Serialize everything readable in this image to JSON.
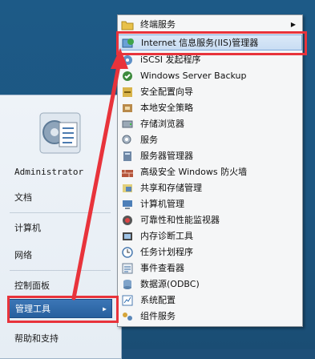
{
  "start_menu": {
    "user_name": "Administrator",
    "items": [
      {
        "label": "文档"
      },
      {
        "label": "计算机"
      },
      {
        "label": "网络"
      },
      {
        "label": "控制面板"
      },
      {
        "label": "管理工具"
      },
      {
        "label": "帮助和支持"
      }
    ],
    "active_index": 4,
    "arrow": "▶"
  },
  "submenu": {
    "items": [
      {
        "label": "终端服务",
        "icon": "folder-icon",
        "has_submenu": true
      },
      {
        "label": "Internet 信息服务(IIS)管理器",
        "icon": "iis-manager-icon"
      },
      {
        "label": "iSCSI 发起程序",
        "icon": "iscsi-icon"
      },
      {
        "label": "Windows Server Backup",
        "icon": "backup-icon"
      },
      {
        "label": "安全配置向导",
        "icon": "security-wizard-icon"
      },
      {
        "label": "本地安全策略",
        "icon": "local-security-policy-icon"
      },
      {
        "label": "存储浏览器",
        "icon": "storage-explorer-icon"
      },
      {
        "label": "服务",
        "icon": "services-icon"
      },
      {
        "label": "服务器管理器",
        "icon": "server-manager-icon"
      },
      {
        "label": "高级安全 Windows 防火墙",
        "icon": "firewall-icon"
      },
      {
        "label": "共享和存储管理",
        "icon": "share-storage-icon"
      },
      {
        "label": "计算机管理",
        "icon": "computer-management-icon"
      },
      {
        "label": "可靠性和性能监视器",
        "icon": "performance-monitor-icon"
      },
      {
        "label": "内存诊断工具",
        "icon": "memory-diagnostics-icon"
      },
      {
        "label": "任务计划程序",
        "icon": "task-scheduler-icon"
      },
      {
        "label": "事件查看器",
        "icon": "event-viewer-icon"
      },
      {
        "label": "数据源(ODBC)",
        "icon": "odbc-icon"
      },
      {
        "label": "系统配置",
        "icon": "system-config-icon"
      },
      {
        "label": "组件服务",
        "icon": "component-services-icon"
      }
    ],
    "arrow": "▶"
  },
  "colors": {
    "highlight": "#e8333b",
    "active_item": "#2f68a8",
    "desktop": "#1d5a87"
  }
}
